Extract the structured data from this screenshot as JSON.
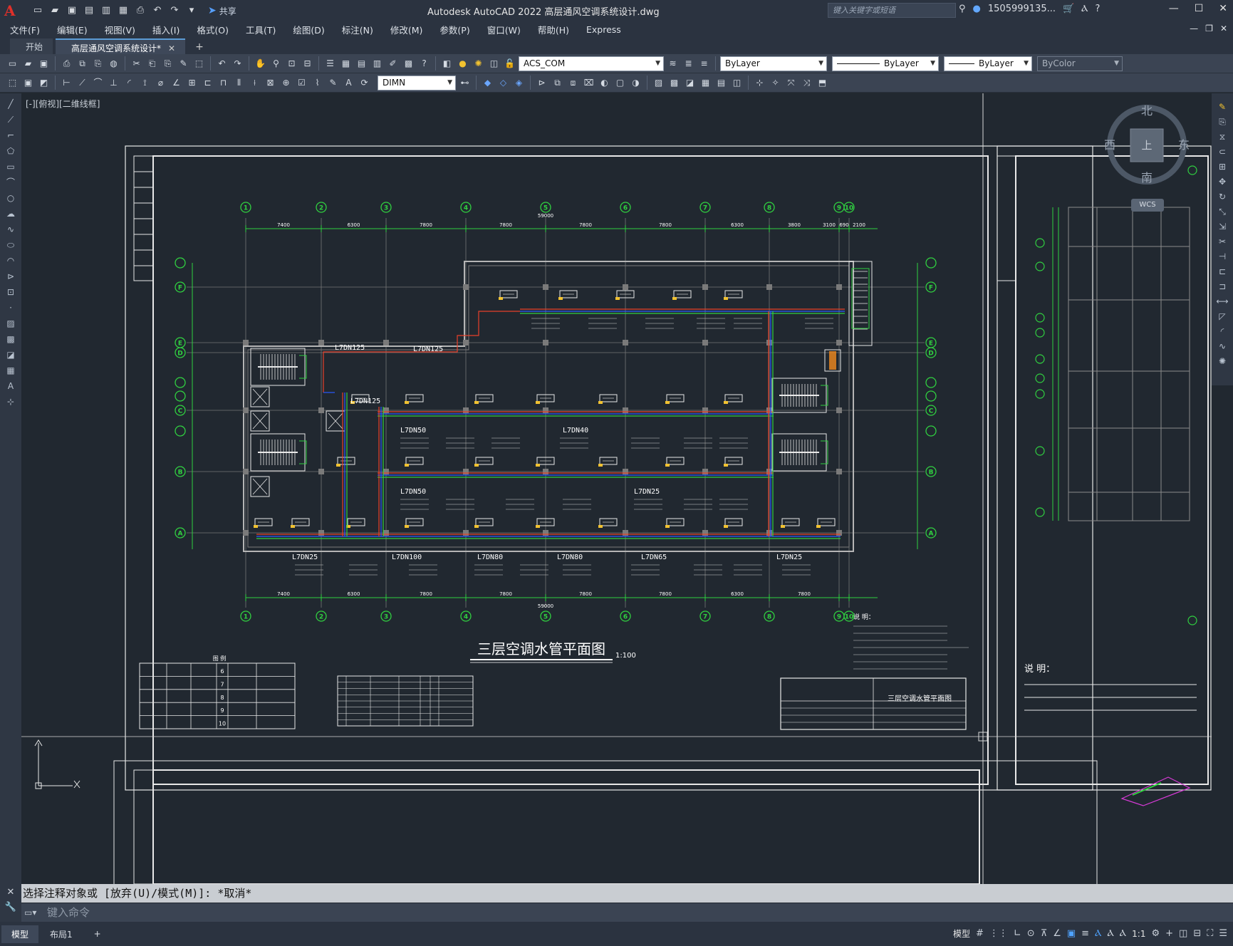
{
  "app": {
    "title": "Autodesk AutoCAD 2022    高层通风空调系统设计.dwg",
    "logo": "A",
    "share_label": "共享",
    "search_placeholder": "键入关键字或短语",
    "user": "1505999135...",
    "accent": "#e0302a"
  },
  "menu": {
    "items": [
      "文件(F)",
      "编辑(E)",
      "视图(V)",
      "插入(I)",
      "格式(O)",
      "工具(T)",
      "绘图(D)",
      "标注(N)",
      "修改(M)",
      "参数(P)",
      "窗口(W)",
      "帮助(H)",
      "Express"
    ]
  },
  "tabs": {
    "items": [
      {
        "label": "开始"
      },
      {
        "label": "高层通风空调系统设计*"
      }
    ],
    "add": "+"
  },
  "toolbar": {
    "layer": "ACS_COM",
    "color": "ByLayer",
    "linetype": "ByLayer",
    "lineweight": "ByLayer",
    "plotstyle": "ByColor",
    "dimstyle": "DIMN"
  },
  "canvas": {
    "view_label": "[-][俯视][二维线框]",
    "viewcube": {
      "north": "北",
      "south": "南",
      "east": "东",
      "west": "西",
      "top": "上"
    },
    "wcs": "WCS"
  },
  "drawing": {
    "title": "三层空调水管平面图",
    "scale": "1:100",
    "titleblock_name": "三层空调水管平面图",
    "grid_numbers": [
      "1",
      "2",
      "3",
      "4",
      "5",
      "6",
      "7",
      "8",
      "9",
      "10"
    ],
    "grid_letters": [
      "A",
      "B",
      "C",
      "D",
      "E",
      "F"
    ],
    "spans_top": [
      "7400",
      "6300",
      "7800",
      "7800",
      "7800",
      "7800",
      "6300",
      "3800",
      "3100",
      "690",
      "2100"
    ],
    "spans_bottom": [
      "7400",
      "6300",
      "7800",
      "7800",
      "7800",
      "7800",
      "6300",
      "7800"
    ],
    "overall": "59000",
    "pipe_labels": [
      "L7DN125",
      "L7DN125",
      "L7DN125",
      "L7DN50",
      "L7DN50",
      "L7DN40",
      "L7DN25",
      "L7DN25",
      "L7DN100",
      "L7DN80",
      "L7DN80",
      "L7DN65",
      "L7DN25"
    ],
    "notes_title": "说 明：",
    "legend_title": "图 例",
    "right_notes_title": "说 明："
  },
  "command": {
    "history": "选择注释对象或 [放弃(U)/模式(M)]: *取消*",
    "placeholder": "键入命令"
  },
  "status": {
    "layout_tabs": [
      "模型",
      "布局1"
    ],
    "model_label": "模型",
    "scale": "1:1"
  }
}
